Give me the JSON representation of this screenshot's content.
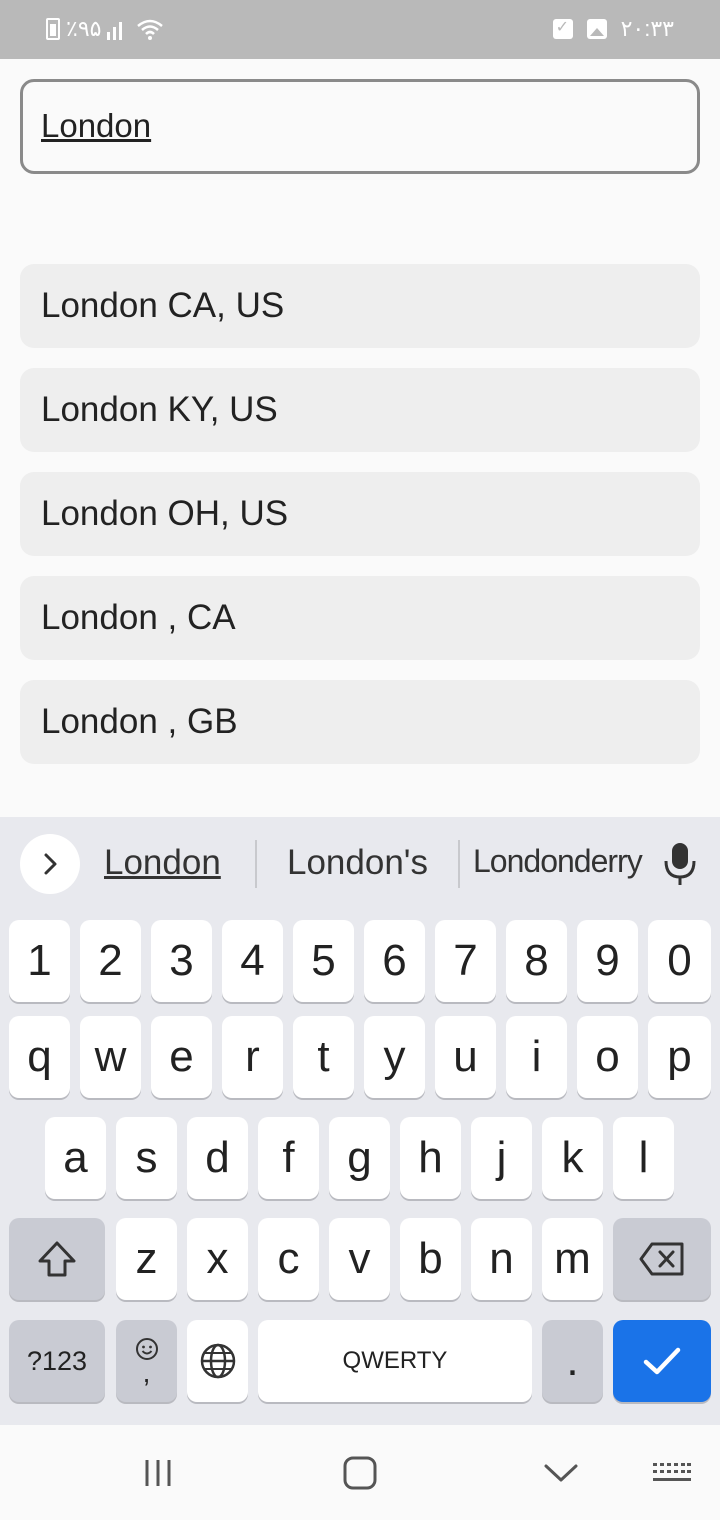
{
  "status_bar": {
    "battery_text": "٪۹۵",
    "time": "۲۰:۳۳"
  },
  "search": {
    "value": "London",
    "placeholder": ""
  },
  "results": [
    "London CA, US",
    "London KY, US",
    "London OH, US",
    "London , CA",
    "London , GB"
  ],
  "keyboard": {
    "suggestions": [
      "London",
      "London's",
      "Londonderry"
    ],
    "number_row": [
      "1",
      "2",
      "3",
      "4",
      "5",
      "6",
      "7",
      "8",
      "9",
      "0"
    ],
    "row1": [
      "q",
      "w",
      "e",
      "r",
      "t",
      "y",
      "u",
      "i",
      "o",
      "p"
    ],
    "row2": [
      "a",
      "s",
      "d",
      "f",
      "g",
      "h",
      "j",
      "k",
      "l"
    ],
    "row3": [
      "z",
      "x",
      "c",
      "v",
      "b",
      "n",
      "m"
    ],
    "symbols_label": "?123",
    "comma_label": ",",
    "space_label": "QWERTY",
    "period_label": ".",
    "accent_color": "#1a73e8"
  },
  "icons": {
    "status": [
      "battery-charging-icon",
      "signal-icon",
      "wifi-icon",
      "checkbox-notification-icon",
      "image-notification-icon"
    ],
    "keyboard": [
      "chevron-right-icon",
      "microphone-icon",
      "shift-icon",
      "backspace-icon",
      "emoji-icon",
      "globe-icon",
      "checkmark-icon"
    ],
    "nav": [
      "recent-apps-icon",
      "home-icon",
      "back-icon",
      "keyboard-switch-icon"
    ]
  }
}
